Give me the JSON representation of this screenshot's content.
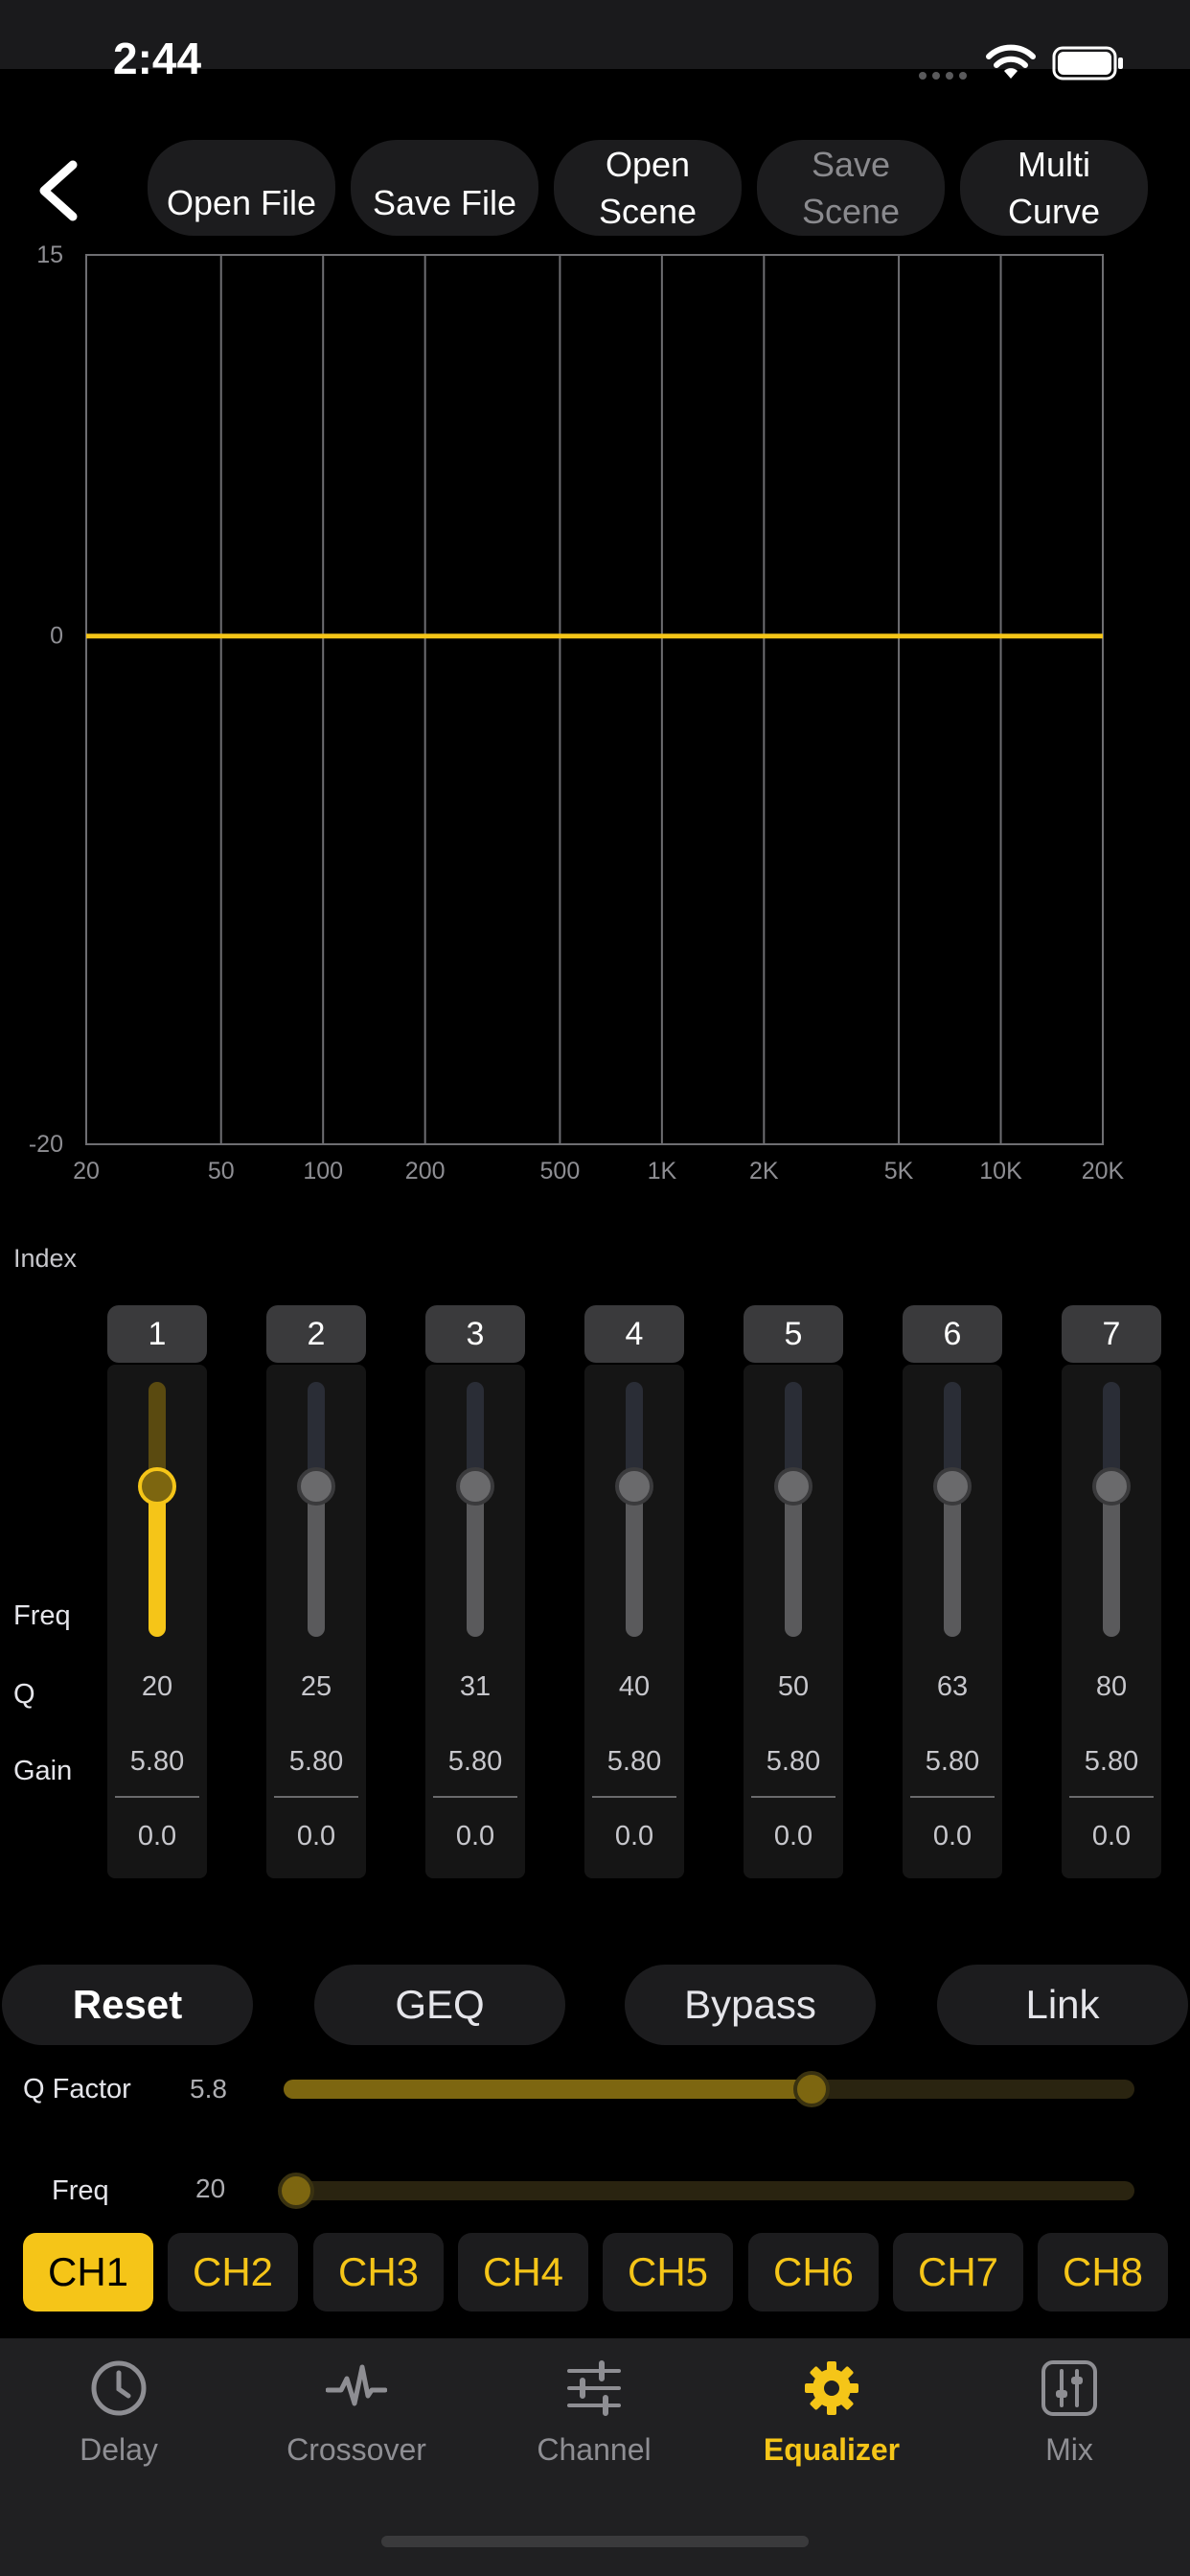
{
  "status_bar": {
    "time": "2:44"
  },
  "toolbar": {
    "buttons": [
      {
        "label": "Open File",
        "enabled": true
      },
      {
        "label": "Save File",
        "enabled": true
      },
      {
        "label": "Open\nScene",
        "enabled": true
      },
      {
        "label": "Save\nScene",
        "enabled": false
      },
      {
        "label": "Multi\nCurve",
        "enabled": true
      }
    ]
  },
  "chart_data": {
    "type": "line",
    "x_scale": "log",
    "x_ticks": [
      "20",
      "50",
      "100",
      "200",
      "500",
      "1K",
      "2K",
      "5K",
      "10K",
      "20K"
    ],
    "y_ticks": [
      "15",
      "0",
      "-20"
    ],
    "ylim": [
      -20,
      15
    ],
    "xlim": [
      20,
      20000
    ],
    "series": [
      {
        "color": "#F5C518",
        "points": [
          [
            20,
            0
          ],
          [
            20000,
            0
          ]
        ]
      }
    ]
  },
  "bands": {
    "row_labels": {
      "index": "Index",
      "freq": "Freq",
      "q": "Q",
      "gain": "Gain"
    },
    "items": [
      {
        "index": "1",
        "freq": "20",
        "q": "5.80",
        "gain": "0.0",
        "selected": true
      },
      {
        "index": "2",
        "freq": "25",
        "q": "5.80",
        "gain": "0.0",
        "selected": false
      },
      {
        "index": "3",
        "freq": "31",
        "q": "5.80",
        "gain": "0.0",
        "selected": false
      },
      {
        "index": "4",
        "freq": "40",
        "q": "5.80",
        "gain": "0.0",
        "selected": false
      },
      {
        "index": "5",
        "freq": "50",
        "q": "5.80",
        "gain": "0.0",
        "selected": false
      },
      {
        "index": "6",
        "freq": "63",
        "q": "5.80",
        "gain": "0.0",
        "selected": false
      },
      {
        "index": "7",
        "freq": "80",
        "q": "5.80",
        "gain": "0.0",
        "selected": false
      }
    ]
  },
  "actions": {
    "reset": "Reset",
    "geq": "GEQ",
    "bypass": "Bypass",
    "link": "Link"
  },
  "controls": {
    "q_factor": {
      "label": "Q Factor",
      "value": "5.8",
      "fraction": 0.62
    },
    "freq": {
      "label": "Freq",
      "value": "20",
      "fraction": 0.0
    }
  },
  "channels": {
    "items": [
      "CH1",
      "CH2",
      "CH3",
      "CH4",
      "CH5",
      "CH6",
      "CH7",
      "CH8"
    ],
    "active": "CH1"
  },
  "tabs": [
    {
      "label": "Delay",
      "icon": "clock-icon",
      "active": false
    },
    {
      "label": "Crossover",
      "icon": "waveform-icon",
      "active": false
    },
    {
      "label": "Channel",
      "icon": "sliders-icon",
      "active": false
    },
    {
      "label": "Equalizer",
      "icon": "gear-icon",
      "active": true
    },
    {
      "label": "Mix",
      "icon": "mixer-icon",
      "active": false
    }
  ],
  "colors": {
    "accent": "#F5C518",
    "background": "#000000",
    "tabbar": "#202022"
  }
}
